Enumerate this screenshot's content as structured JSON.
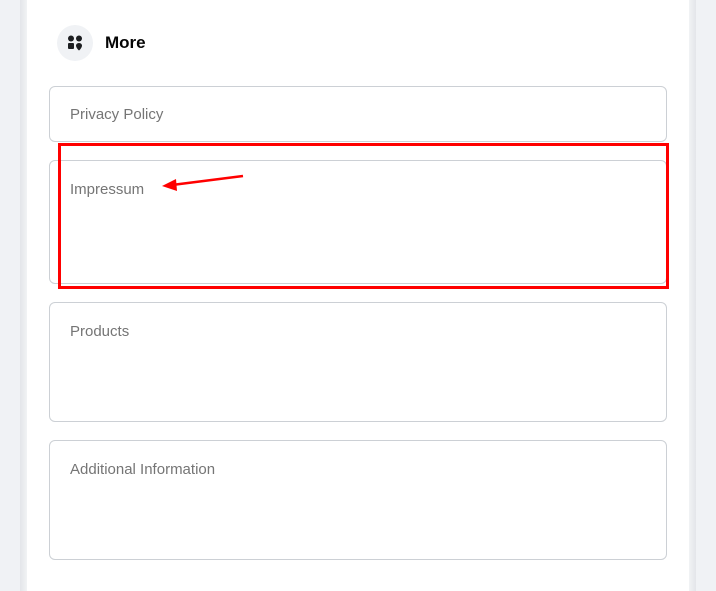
{
  "section": {
    "title": "More"
  },
  "fields": {
    "privacy": {
      "label": "Privacy Policy"
    },
    "impressum": {
      "label": "Impressum"
    },
    "products": {
      "label": "Products"
    },
    "additional": {
      "label": "Additional Information"
    }
  },
  "annotation": {
    "highlight_target": "impressum",
    "highlight_color": "#ff0000"
  }
}
